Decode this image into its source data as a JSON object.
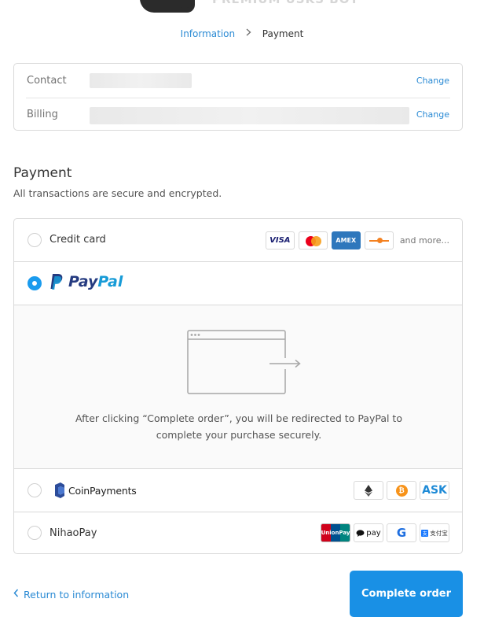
{
  "header": {
    "brand_text": "PREMIUM USKS BOT",
    "icon": "brand-logo"
  },
  "breadcrumb": {
    "information": "Information",
    "separator_icon": "chevron-right-icon",
    "payment": "Payment"
  },
  "review": {
    "contact_label": "Contact",
    "contact_change": "Change",
    "billing_label": "Billing",
    "billing_change": "Change"
  },
  "payment": {
    "title": "Payment",
    "subtitle": "All transactions are secure and encrypted.",
    "methods": [
      {
        "label": "Credit card",
        "selected": false,
        "icons": [
          "VISA",
          "mastercard-icon",
          "AMEX",
          "discover-icon"
        ],
        "and_more": "and more..."
      },
      {
        "label_pay": "Pay",
        "label_pal": "Pal",
        "selected": true,
        "redirect_text": "After clicking “Complete order”, you will be redirected to PayPal to complete your purchase securely."
      },
      {
        "label": "CoinPayments",
        "selected": false,
        "icons": [
          "ethereum-icon",
          "bitcoin-icon",
          "ASK"
        ]
      },
      {
        "label": "NihaoPay",
        "selected": false,
        "icons": [
          "UnionPay",
          "pay",
          "G",
          "支付宝"
        ]
      }
    ]
  },
  "footer": {
    "return_label": "Return to information",
    "complete_label": "Complete order"
  },
  "colors": {
    "accent": "#1990e5",
    "link": "#2a8ad4",
    "paypal_dark": "#253b80",
    "paypal_light": "#179bd7"
  }
}
